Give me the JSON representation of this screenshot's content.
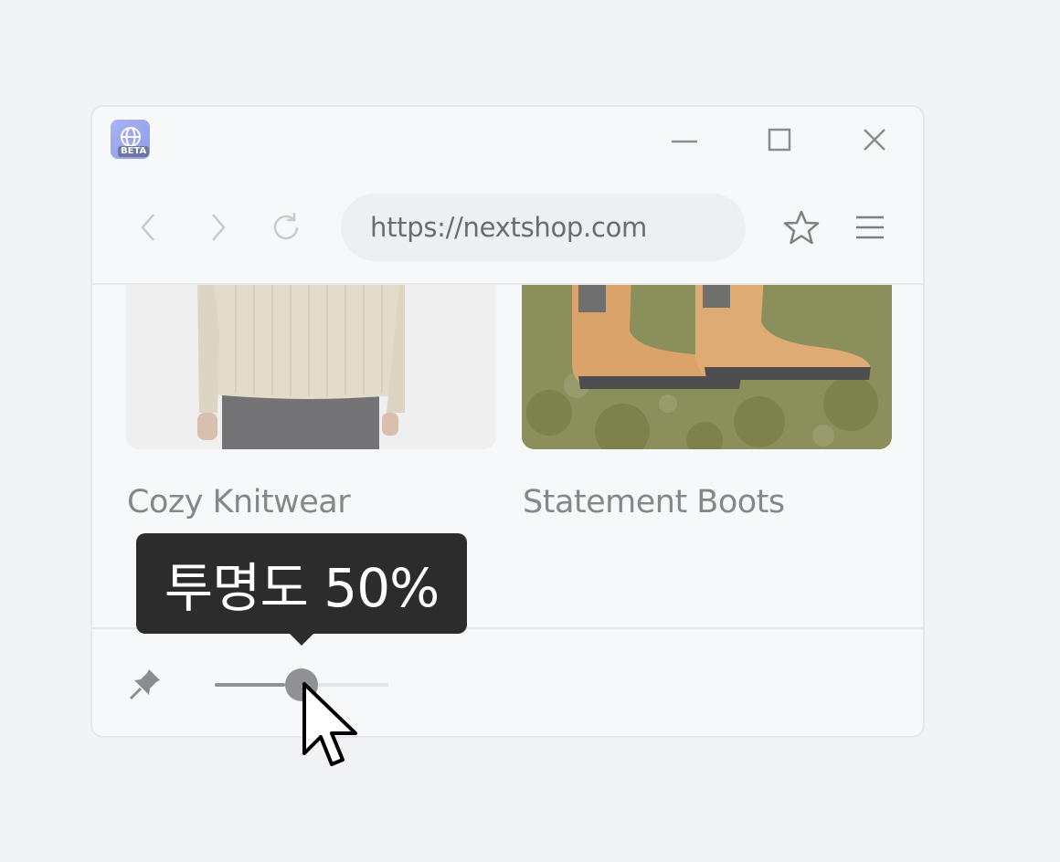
{
  "window": {
    "app_icon": "globe-icon",
    "badge": "BETA",
    "controls": [
      "minimize-icon",
      "maximize-icon",
      "close-icon"
    ]
  },
  "navbar": {
    "back_icon": "chevron-left-icon",
    "forward_icon": "chevron-right-icon",
    "reload_icon": "reload-icon",
    "url": "https://nextshop.com",
    "bookmark_icon": "star-icon",
    "menu_icon": "hamburger-menu-icon"
  },
  "products": [
    {
      "label": "Cozy Knitwear"
    },
    {
      "label": "Statement Boots"
    }
  ],
  "opacity_bar": {
    "pin_icon": "pin-icon",
    "value_percent": 50,
    "tooltip": "투명도 50%"
  },
  "colors": {
    "window_bg": "#f7f8fa",
    "page_bg": "#f2f3f5",
    "tooltip_bg": "#2c2c2d",
    "icon_gray": "#8f9194"
  }
}
